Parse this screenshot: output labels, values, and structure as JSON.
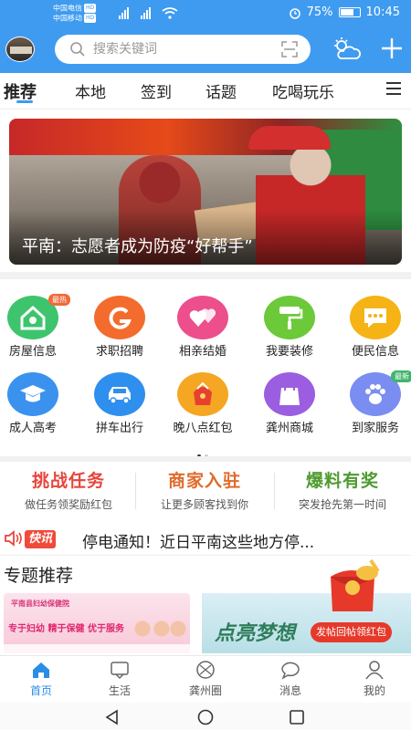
{
  "status": {
    "carrier1": "中国电信",
    "carrier2": "中国移动",
    "network1": "HD",
    "network2": "HD",
    "battery": "75%",
    "battery_level": 0.75,
    "time": "10:45"
  },
  "header": {
    "search_placeholder": "搜索关键词",
    "accent": "#3f9bf0"
  },
  "tabs": [
    "推荐",
    "本地",
    "签到",
    "话题",
    "吃喝玩乐"
  ],
  "banner": {
    "caption": "平南：志愿者成为防疫“好帮手”"
  },
  "grid": [
    {
      "label": "房屋信息",
      "icon": "house-icon",
      "color": "#3ec46d",
      "badge": "最热"
    },
    {
      "label": "求职招聘",
      "icon": "job-icon",
      "color": "#f36c2e"
    },
    {
      "label": "相亲结婚",
      "icon": "hearts-icon",
      "color": "#ec4f8c"
    },
    {
      "label": "我要装修",
      "icon": "paint-roller-icon",
      "color": "#6cc93a"
    },
    {
      "label": "便民信息",
      "icon": "chat-icon",
      "color": "#f5b316"
    },
    {
      "label": "成人高考",
      "icon": "graduation-cap-icon",
      "color": "#3a92ee"
    },
    {
      "label": "拼车出行",
      "icon": "car-icon",
      "color": "#2f8fee"
    },
    {
      "label": "晚八点红包",
      "icon": "red-envelope-icon",
      "color": "#f5a623"
    },
    {
      "label": "龚州商城",
      "icon": "shopping-bag-icon",
      "color": "#9b5ee0"
    },
    {
      "label": "到家服务",
      "icon": "paw-icon",
      "color": "#7a8df0",
      "badge": "最新"
    }
  ],
  "promos": [
    {
      "title": "挑战任务",
      "sub": "做任务领奖励红包",
      "color": "#e8453c"
    },
    {
      "title": "商家入驻",
      "sub": "让更多顾客找到你",
      "color": "#e06a2b"
    },
    {
      "title": "爆料有奖",
      "sub": "突发抢先第一时间",
      "color": "#4f9a2f"
    }
  ],
  "news": {
    "tag": "快讯",
    "text": "停电通知！近日平南这些地方停..."
  },
  "special": {
    "title": "专题推荐",
    "card1_logo": "平南县妇幼保健院",
    "card1_slogan": "专于妇幼 精于保健 优于服务",
    "card2_big": "点亮梦想",
    "redpack_button": "发帖回帖领红包"
  },
  "bottom_nav": [
    {
      "label": "首页",
      "icon": "home-icon",
      "active": true
    },
    {
      "label": "生活",
      "icon": "life-icon"
    },
    {
      "label": "龚州圈",
      "icon": "circle-icon"
    },
    {
      "label": "消息",
      "icon": "message-icon"
    },
    {
      "label": "我的",
      "icon": "profile-icon"
    }
  ]
}
